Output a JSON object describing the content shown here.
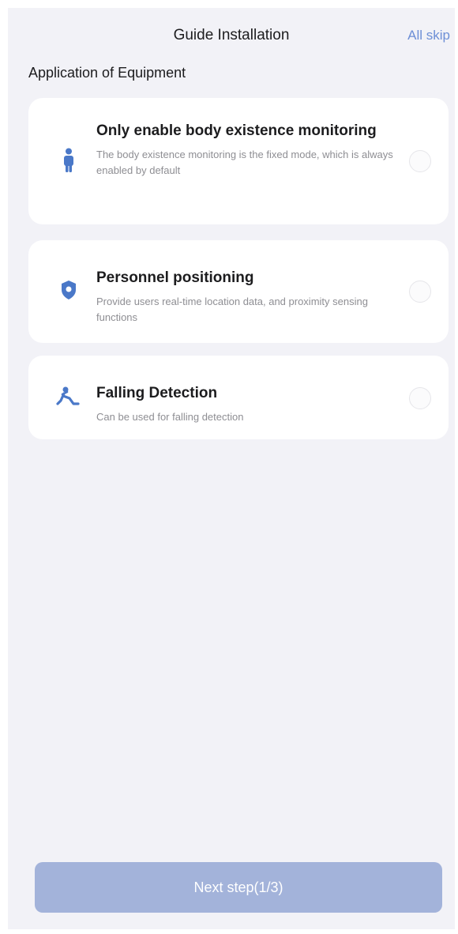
{
  "header": {
    "title": "Guide Installation",
    "skip_label": "All skip"
  },
  "section": {
    "title": "Application of Equipment"
  },
  "options": [
    {
      "icon": "person-icon",
      "title": "Only enable body existence monitoring",
      "description": "The body existence monitoring is the fixed mode, which is always enabled by default"
    },
    {
      "icon": "location-shield-icon",
      "title": "Personnel positioning",
      "description": "Provide users real-time location data, and proximity sensing functions"
    },
    {
      "icon": "falling-person-icon",
      "title": "Falling Detection",
      "description": "Can be used for falling detection"
    }
  ],
  "footer": {
    "next_label": "Next step(1/3)"
  },
  "colors": {
    "accent": "#6d8fd6",
    "icon": "#4a78c8",
    "button_disabled": "#a3b3da",
    "background": "#f2f2f7"
  }
}
